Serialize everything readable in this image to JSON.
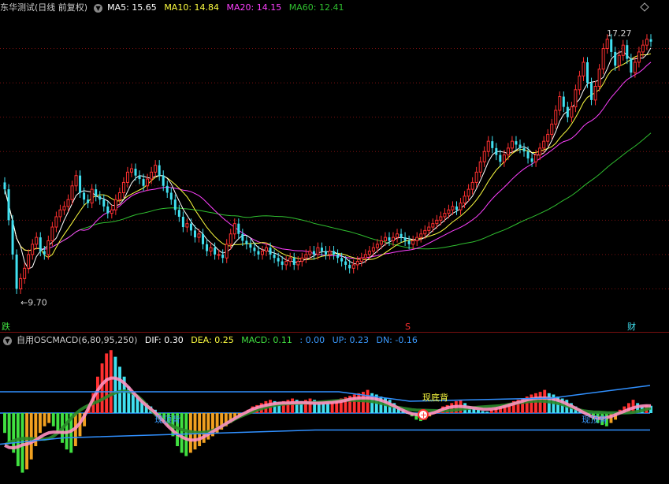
{
  "header": {
    "title": "东华测试(日线 前复权)",
    "ma5": "MA5: 15.65",
    "ma10": "MA10: 14.84",
    "ma20": "MA20: 14.15",
    "ma60": "MA60: 12.41"
  },
  "sub_header": {
    "title": "自用OSCMACD(6,80,95,250)",
    "dif": "DIF: 0.30",
    "dea": "DEA: 0.25",
    "macd": "MACD: 0.11",
    "blank": ": 0.00",
    "up": "UP: 0.23",
    "dn": "DN: -0.16"
  },
  "markers": {
    "high_label": "17.27",
    "low_label": "9.70",
    "left_flag": "跌",
    "mid_flag": "S",
    "right_flag": "财",
    "sub_text_1": "现顶背",
    "sub_text_2": "现底背",
    "sub_text_3": "现顶背"
  },
  "colors": {
    "up": "#ff3030",
    "down": "#40e0f0",
    "ma5": "#ffffff",
    "ma10": "#ffff40",
    "ma20": "#ff40ff",
    "ma60": "#30c030",
    "dif": "#ff90c0",
    "dea": "#2a8a2a",
    "band": "#3090ff"
  },
  "chart_data": [
    {
      "type": "candlestick",
      "title": "东华测试(日线 前复权)",
      "ylim": [
        9.0,
        18.0
      ],
      "price_high": 17.27,
      "price_low": 9.7,
      "x": [
        0,
        1,
        2,
        3,
        4,
        5,
        6,
        7,
        8,
        9,
        10,
        11,
        12,
        13,
        14,
        15,
        16,
        17,
        18,
        19,
        20,
        21,
        22,
        23,
        24,
        25,
        26,
        27,
        28,
        29,
        30,
        31,
        32,
        33,
        34,
        35,
        36,
        37,
        38,
        39,
        40,
        41,
        42,
        43,
        44,
        45,
        46,
        47,
        48,
        49,
        50,
        51,
        52,
        53,
        54,
        55,
        56,
        57,
        58,
        59,
        60,
        61,
        62,
        63,
        64,
        65,
        66,
        67,
        68,
        69,
        70,
        71,
        72,
        73,
        74,
        75,
        76,
        77,
        78,
        79,
        80,
        81,
        82,
        83,
        84,
        85,
        86,
        87,
        88,
        89,
        90,
        91,
        92,
        93,
        94,
        95,
        96,
        97,
        98,
        99,
        100,
        101,
        102,
        103,
        104,
        105,
        106,
        107,
        108,
        109,
        110,
        111,
        112,
        113,
        114,
        115,
        116,
        117,
        118,
        119,
        120,
        121,
        122,
        123,
        124,
        125,
        126,
        127,
        128,
        129,
        130,
        131,
        132,
        133,
        134,
        135,
        136,
        137,
        138,
        139,
        140,
        141,
        142,
        143,
        144,
        145,
        146,
        147,
        148,
        149,
        150,
        151,
        152,
        153,
        154,
        155,
        156,
        157,
        158,
        159,
        160,
        161,
        162,
        163,
        164
      ],
      "close": [
        12.9,
        12.0,
        11.0,
        10.0,
        10.3,
        10.6,
        11.0,
        11.3,
        11.5,
        11.1,
        11.0,
        11.4,
        11.8,
        12.1,
        12.3,
        12.4,
        12.6,
        13.0,
        13.3,
        12.8,
        12.6,
        12.5,
        12.9,
        12.7,
        12.6,
        12.4,
        12.2,
        12.3,
        12.6,
        12.8,
        13.1,
        13.4,
        13.5,
        13.3,
        13.2,
        13.0,
        13.2,
        13.4,
        13.6,
        13.3,
        13.0,
        12.8,
        12.6,
        12.3,
        12.1,
        11.8,
        11.9,
        11.7,
        11.5,
        11.6,
        11.3,
        11.1,
        11.2,
        11.0,
        11.0,
        10.9,
        11.3,
        11.6,
        11.9,
        11.6,
        11.4,
        11.3,
        11.2,
        11.1,
        11.0,
        11.1,
        11.2,
        11.0,
        10.9,
        10.8,
        10.7,
        10.8,
        10.9,
        10.7,
        10.8,
        10.9,
        11.0,
        11.1,
        11.0,
        11.2,
        11.1,
        11.0,
        11.1,
        11.0,
        10.9,
        10.8,
        10.7,
        10.6,
        10.7,
        10.8,
        10.9,
        11.0,
        11.1,
        11.2,
        11.3,
        11.4,
        11.5,
        11.4,
        11.5,
        11.6,
        11.5,
        11.4,
        11.3,
        11.4,
        11.5,
        11.6,
        11.7,
        11.8,
        11.9,
        12.0,
        12.1,
        12.2,
        12.3,
        12.4,
        12.3,
        12.5,
        12.7,
        12.9,
        13.1,
        13.4,
        13.7,
        14.0,
        14.3,
        14.1,
        13.9,
        13.7,
        13.9,
        14.1,
        14.3,
        14.2,
        14.1,
        14.0,
        13.8,
        13.7,
        13.9,
        14.1,
        14.3,
        14.5,
        14.8,
        15.2,
        15.6,
        15.3,
        15.0,
        15.3,
        15.8,
        16.2,
        16.6,
        16.0,
        15.5,
        15.9,
        16.4,
        17.0,
        17.27,
        16.9,
        16.5,
        16.8,
        17.1,
        16.7,
        16.3,
        16.6,
        16.9,
        17.1,
        17.27,
        17.2
      ],
      "series": [
        {
          "name": "MA5",
          "value": 15.65
        },
        {
          "name": "MA10",
          "value": 14.84
        },
        {
          "name": "MA20",
          "value": 14.15
        },
        {
          "name": "MA60",
          "value": 12.41
        }
      ]
    },
    {
      "type": "bar",
      "title": "自用OSCMACD(6,80,95,250)",
      "ylim": [
        -1.0,
        1.0
      ],
      "values": [
        -0.3,
        -0.45,
        -0.6,
        -0.8,
        -0.9,
        -0.85,
        -0.7,
        -0.5,
        -0.3,
        -0.2,
        -0.15,
        -0.2,
        -0.3,
        -0.45,
        -0.55,
        -0.6,
        -0.5,
        -0.35,
        -0.2,
        0.1,
        0.3,
        0.55,
        0.75,
        0.9,
        0.95,
        0.85,
        0.7,
        0.55,
        0.4,
        0.3,
        0.25,
        0.2,
        0.15,
        0.1,
        0.05,
        -0.05,
        -0.1,
        -0.2,
        -0.35,
        -0.5,
        -0.6,
        -0.65,
        -0.6,
        -0.55,
        -0.5,
        -0.45,
        -0.4,
        -0.35,
        -0.3,
        -0.25,
        -0.2,
        -0.15,
        -0.1,
        -0.05,
        0.0,
        0.05,
        0.1,
        0.12,
        0.15,
        0.18,
        0.2,
        0.18,
        0.16,
        0.18,
        0.2,
        0.22,
        0.2,
        0.18,
        0.2,
        0.22,
        0.2,
        0.18,
        0.16,
        0.15,
        0.18,
        0.2,
        0.22,
        0.24,
        0.26,
        0.28,
        0.3,
        0.32,
        0.35,
        0.3,
        0.28,
        0.25,
        0.22,
        0.2,
        0.15,
        0.1,
        0.05,
        0.0,
        -0.05,
        -0.1,
        -0.12,
        -0.1,
        -0.05,
        0.0,
        0.05,
        0.1,
        0.12,
        0.15,
        0.18,
        0.2,
        0.15,
        0.1,
        0.08,
        0.05,
        0.03,
        0.02,
        0.05,
        0.08,
        0.1,
        0.12,
        0.15,
        0.18,
        0.2,
        0.22,
        0.25,
        0.28,
        0.3,
        0.32,
        0.35,
        0.3,
        0.28,
        0.25,
        0.22,
        0.2,
        0.15,
        0.1,
        0.05,
        0.0,
        -0.05,
        -0.1,
        -0.15,
        -0.18,
        -0.2,
        -0.15,
        -0.1,
        0.05,
        0.1,
        0.15,
        0.2,
        0.15,
        0.1,
        0.12,
        0.11
      ],
      "series": [
        {
          "name": "DIF",
          "value": 0.3
        },
        {
          "name": "DEA",
          "value": 0.25
        },
        {
          "name": "MACD",
          "value": 0.11
        },
        {
          "name": "UP",
          "value": 0.23
        },
        {
          "name": "DN",
          "value": -0.16
        }
      ]
    }
  ]
}
